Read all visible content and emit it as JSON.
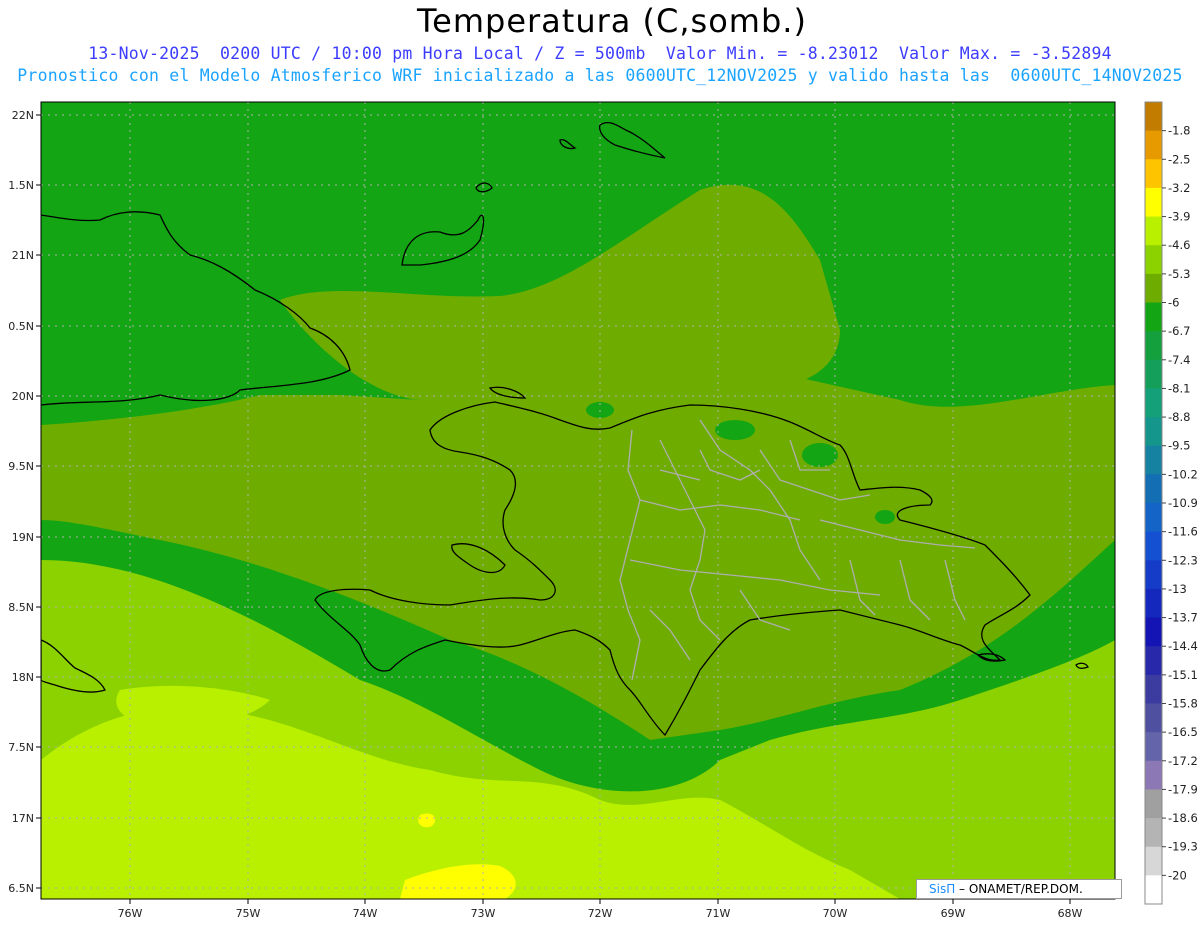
{
  "header": {
    "title": "Temperatura (C,somb.)",
    "subtitle_1": "13-Nov-2025  0200 UTC / 10:00 pm Hora Local / Z = 500mb  Valor Min. = -8.23012  Valor Max. = -3.52894",
    "subtitle_2": "Pronostico con el Modelo Atmosferico WRF inicializado a las 0600UTC_12NOV2025 y valido hasta las  0600UTC_14NOV2025"
  },
  "axes": {
    "lat_labels": [
      "22N",
      "1.5N",
      "21N",
      "0.5N",
      "20N",
      "9.5N",
      "19N",
      "8.5N",
      "18N",
      "7.5N",
      "17N",
      "6.5N"
    ],
    "lon_labels": [
      "76W",
      "75W",
      "74W",
      "73W",
      "72W",
      "71W",
      "70W",
      "69W",
      "68W"
    ]
  },
  "colorbar": {
    "labels": [
      "-1.8",
      "-2.5",
      "-3.2",
      "-3.9",
      "-4.6",
      "-5.3",
      "-6",
      "-6.7",
      "-7.4",
      "-8.1",
      "-8.8",
      "-9.5",
      "-10.2",
      "-10.9",
      "-11.6",
      "-12.3",
      "-13",
      "-13.7",
      "-14.4",
      "-15.1",
      "-15.8",
      "-16.5",
      "-17.2",
      "-17.9",
      "-18.6",
      "-19.3",
      "-20"
    ],
    "colors": [
      "#c27c00",
      "#e69a00",
      "#ffc400",
      "#ffff00",
      "#b8f000",
      "#8cd200",
      "#6ead00",
      "#14a514",
      "#14a03c",
      "#14a05a",
      "#14a078",
      "#14968c",
      "#1482a0",
      "#146eb4",
      "#1464c8",
      "#1450d2",
      "#143cc8",
      "#1428be",
      "#1414b4",
      "#2828aa",
      "#3c3ca0",
      "#5050a0",
      "#6464aa",
      "#8c78b4",
      "#a0a0a0",
      "#b4b4b4",
      "#d7d7d7",
      "#ffffff"
    ]
  },
  "fields": {
    "ocean_north": "#14a514",
    "band_mid": "#6ead00",
    "band_south": "#8cd200",
    "band_far_south": "#b8f000",
    "spot_yellow": "#ffff00"
  },
  "credit": {
    "brand": "SisΠ",
    "text": " – ONAMET/REP.DOM."
  }
}
